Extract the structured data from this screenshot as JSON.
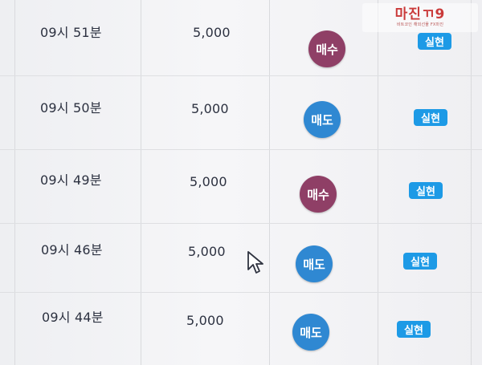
{
  "watermark": {
    "brand": "마진",
    "brand_suffix": "ㄲ9",
    "subtitle": "비트코인 해외선물 FX마진"
  },
  "rows": [
    {
      "time": "09시 51분",
      "amount": "5,000",
      "side": "매수",
      "side_type": "buy",
      "status": "실현"
    },
    {
      "time": "09시 50분",
      "amount": "5,000",
      "side": "매도",
      "side_type": "sell",
      "status": "실현"
    },
    {
      "time": "09시 49분",
      "amount": "5,000",
      "side": "매수",
      "side_type": "buy",
      "status": "실현"
    },
    {
      "time": "09시 46분",
      "amount": "5,000",
      "side": "매도",
      "side_type": "sell",
      "status": "실현"
    },
    {
      "time": "09시 44분",
      "amount": "5,000",
      "side": "매도",
      "side_type": "sell",
      "status": "실현"
    }
  ],
  "colors": {
    "buy": "#8f3f66",
    "sell": "#2f88d2",
    "status": "#1d9ae6",
    "watermark_red": "#ca3a3a"
  }
}
